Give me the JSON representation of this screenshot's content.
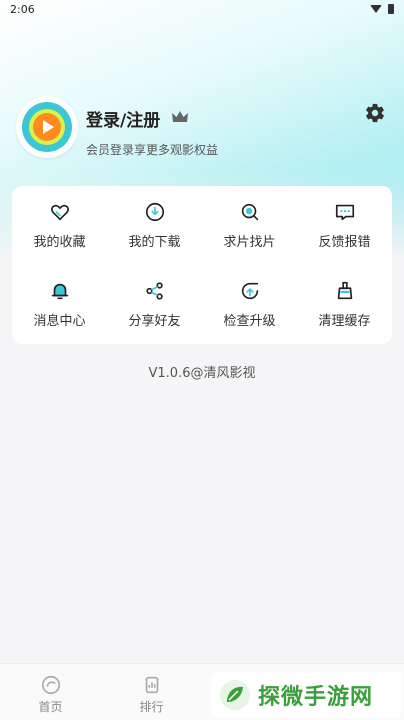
{
  "status": {
    "time": "2:06"
  },
  "profile": {
    "title": "登录/注册",
    "subtitle": "会员登录享更多观影权益"
  },
  "grid": [
    {
      "label": "我的收藏",
      "icon": "heart-icon"
    },
    {
      "label": "我的下载",
      "icon": "download-icon"
    },
    {
      "label": "求片找片",
      "icon": "search-film-icon"
    },
    {
      "label": "反馈报错",
      "icon": "feedback-icon"
    },
    {
      "label": "消息中心",
      "icon": "bell-icon"
    },
    {
      "label": "分享好友",
      "icon": "share-icon"
    },
    {
      "label": "检查升级",
      "icon": "upgrade-icon"
    },
    {
      "label": "清理缓存",
      "icon": "broom-icon"
    }
  ],
  "version": "V1.0.6@清风影视",
  "tabbar": [
    {
      "label": "首页",
      "icon": "home-icon"
    },
    {
      "label": "排行",
      "icon": "rank-icon"
    },
    {
      "label": "",
      "icon": ""
    },
    {
      "label": "",
      "icon": ""
    }
  ],
  "watermark": {
    "text": "探微手游网"
  },
  "colors": {
    "accent": "#3cc7d6",
    "icon": "#222222",
    "watermark": "#3a9f3a"
  }
}
